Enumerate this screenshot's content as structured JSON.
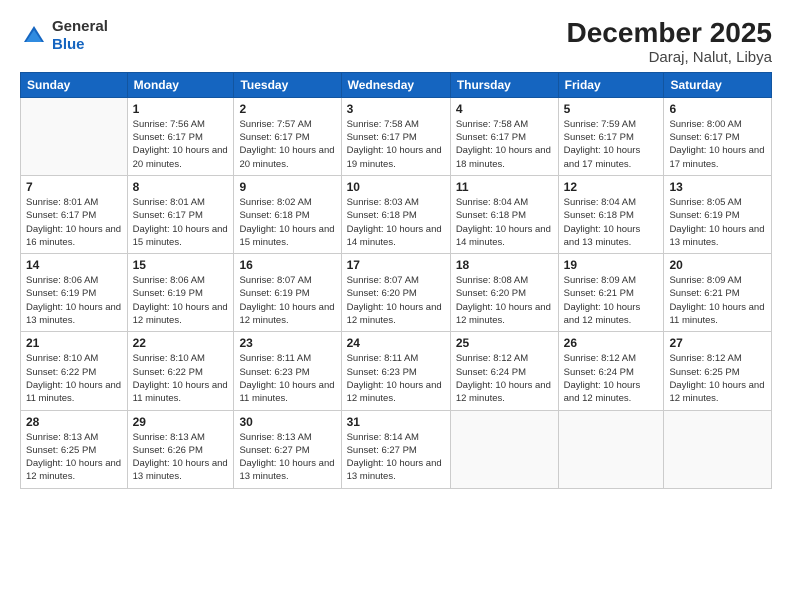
{
  "logo": {
    "line1": "General",
    "line2": "Blue"
  },
  "title": "December 2025",
  "location": "Daraj, Nalut, Libya",
  "days_of_week": [
    "Sunday",
    "Monday",
    "Tuesday",
    "Wednesday",
    "Thursday",
    "Friday",
    "Saturday"
  ],
  "weeks": [
    [
      {
        "num": "",
        "empty": true
      },
      {
        "num": "1",
        "sunrise": "Sunrise: 7:56 AM",
        "sunset": "Sunset: 6:17 PM",
        "daylight": "Daylight: 10 hours and 20 minutes."
      },
      {
        "num": "2",
        "sunrise": "Sunrise: 7:57 AM",
        "sunset": "Sunset: 6:17 PM",
        "daylight": "Daylight: 10 hours and 20 minutes."
      },
      {
        "num": "3",
        "sunrise": "Sunrise: 7:58 AM",
        "sunset": "Sunset: 6:17 PM",
        "daylight": "Daylight: 10 hours and 19 minutes."
      },
      {
        "num": "4",
        "sunrise": "Sunrise: 7:58 AM",
        "sunset": "Sunset: 6:17 PM",
        "daylight": "Daylight: 10 hours and 18 minutes."
      },
      {
        "num": "5",
        "sunrise": "Sunrise: 7:59 AM",
        "sunset": "Sunset: 6:17 PM",
        "daylight": "Daylight: 10 hours and 17 minutes."
      },
      {
        "num": "6",
        "sunrise": "Sunrise: 8:00 AM",
        "sunset": "Sunset: 6:17 PM",
        "daylight": "Daylight: 10 hours and 17 minutes."
      }
    ],
    [
      {
        "num": "7",
        "sunrise": "Sunrise: 8:01 AM",
        "sunset": "Sunset: 6:17 PM",
        "daylight": "Daylight: 10 hours and 16 minutes."
      },
      {
        "num": "8",
        "sunrise": "Sunrise: 8:01 AM",
        "sunset": "Sunset: 6:17 PM",
        "daylight": "Daylight: 10 hours and 15 minutes."
      },
      {
        "num": "9",
        "sunrise": "Sunrise: 8:02 AM",
        "sunset": "Sunset: 6:18 PM",
        "daylight": "Daylight: 10 hours and 15 minutes."
      },
      {
        "num": "10",
        "sunrise": "Sunrise: 8:03 AM",
        "sunset": "Sunset: 6:18 PM",
        "daylight": "Daylight: 10 hours and 14 minutes."
      },
      {
        "num": "11",
        "sunrise": "Sunrise: 8:04 AM",
        "sunset": "Sunset: 6:18 PM",
        "daylight": "Daylight: 10 hours and 14 minutes."
      },
      {
        "num": "12",
        "sunrise": "Sunrise: 8:04 AM",
        "sunset": "Sunset: 6:18 PM",
        "daylight": "Daylight: 10 hours and 13 minutes."
      },
      {
        "num": "13",
        "sunrise": "Sunrise: 8:05 AM",
        "sunset": "Sunset: 6:19 PM",
        "daylight": "Daylight: 10 hours and 13 minutes."
      }
    ],
    [
      {
        "num": "14",
        "sunrise": "Sunrise: 8:06 AM",
        "sunset": "Sunset: 6:19 PM",
        "daylight": "Daylight: 10 hours and 13 minutes."
      },
      {
        "num": "15",
        "sunrise": "Sunrise: 8:06 AM",
        "sunset": "Sunset: 6:19 PM",
        "daylight": "Daylight: 10 hours and 12 minutes."
      },
      {
        "num": "16",
        "sunrise": "Sunrise: 8:07 AM",
        "sunset": "Sunset: 6:19 PM",
        "daylight": "Daylight: 10 hours and 12 minutes."
      },
      {
        "num": "17",
        "sunrise": "Sunrise: 8:07 AM",
        "sunset": "Sunset: 6:20 PM",
        "daylight": "Daylight: 10 hours and 12 minutes."
      },
      {
        "num": "18",
        "sunrise": "Sunrise: 8:08 AM",
        "sunset": "Sunset: 6:20 PM",
        "daylight": "Daylight: 10 hours and 12 minutes."
      },
      {
        "num": "19",
        "sunrise": "Sunrise: 8:09 AM",
        "sunset": "Sunset: 6:21 PM",
        "daylight": "Daylight: 10 hours and 12 minutes."
      },
      {
        "num": "20",
        "sunrise": "Sunrise: 8:09 AM",
        "sunset": "Sunset: 6:21 PM",
        "daylight": "Daylight: 10 hours and 11 minutes."
      }
    ],
    [
      {
        "num": "21",
        "sunrise": "Sunrise: 8:10 AM",
        "sunset": "Sunset: 6:22 PM",
        "daylight": "Daylight: 10 hours and 11 minutes."
      },
      {
        "num": "22",
        "sunrise": "Sunrise: 8:10 AM",
        "sunset": "Sunset: 6:22 PM",
        "daylight": "Daylight: 10 hours and 11 minutes."
      },
      {
        "num": "23",
        "sunrise": "Sunrise: 8:11 AM",
        "sunset": "Sunset: 6:23 PM",
        "daylight": "Daylight: 10 hours and 11 minutes."
      },
      {
        "num": "24",
        "sunrise": "Sunrise: 8:11 AM",
        "sunset": "Sunset: 6:23 PM",
        "daylight": "Daylight: 10 hours and 12 minutes."
      },
      {
        "num": "25",
        "sunrise": "Sunrise: 8:12 AM",
        "sunset": "Sunset: 6:24 PM",
        "daylight": "Daylight: 10 hours and 12 minutes."
      },
      {
        "num": "26",
        "sunrise": "Sunrise: 8:12 AM",
        "sunset": "Sunset: 6:24 PM",
        "daylight": "Daylight: 10 hours and 12 minutes."
      },
      {
        "num": "27",
        "sunrise": "Sunrise: 8:12 AM",
        "sunset": "Sunset: 6:25 PM",
        "daylight": "Daylight: 10 hours and 12 minutes."
      }
    ],
    [
      {
        "num": "28",
        "sunrise": "Sunrise: 8:13 AM",
        "sunset": "Sunset: 6:25 PM",
        "daylight": "Daylight: 10 hours and 12 minutes."
      },
      {
        "num": "29",
        "sunrise": "Sunrise: 8:13 AM",
        "sunset": "Sunset: 6:26 PM",
        "daylight": "Daylight: 10 hours and 13 minutes."
      },
      {
        "num": "30",
        "sunrise": "Sunrise: 8:13 AM",
        "sunset": "Sunset: 6:27 PM",
        "daylight": "Daylight: 10 hours and 13 minutes."
      },
      {
        "num": "31",
        "sunrise": "Sunrise: 8:14 AM",
        "sunset": "Sunset: 6:27 PM",
        "daylight": "Daylight: 10 hours and 13 minutes."
      },
      {
        "num": "",
        "empty": true
      },
      {
        "num": "",
        "empty": true
      },
      {
        "num": "",
        "empty": true
      }
    ]
  ]
}
